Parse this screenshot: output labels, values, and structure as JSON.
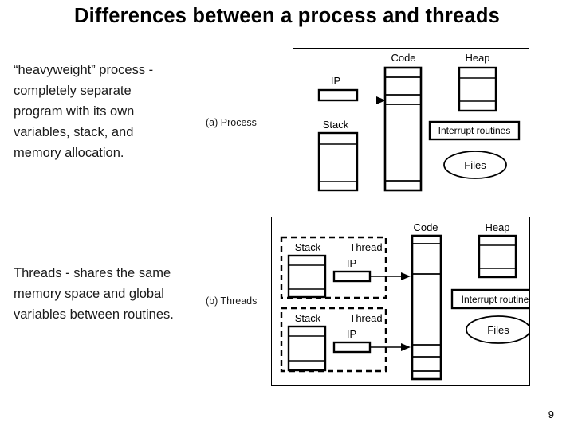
{
  "slide": {
    "title": "Differences between a process and threads",
    "page_number": "9"
  },
  "body": {
    "process_paragraph": {
      "line1": "“heavyweight” process -",
      "line2": "completely separate",
      "line3": "program with its own",
      "line4": "variables, stack, and",
      "line5": "memory allocation."
    },
    "threads_paragraph": {
      "line1": "Threads - shares the same",
      "line2": "memory space and global",
      "line3": "variables between routines."
    }
  },
  "captions": {
    "a": "(a) Process",
    "b": "(b) Threads"
  },
  "figure_process": {
    "ip_label": "IP",
    "stack_label": "Stack",
    "code_label": "Code",
    "heap_label": "Heap",
    "interrupt_label": "Interrupt routines",
    "files_label": "Files"
  },
  "figure_threads": {
    "code_label": "Code",
    "heap_label": "Heap",
    "interrupt_label": "Interrupt routines",
    "files_label": "Files",
    "threads": [
      {
        "stack_label": "Stack",
        "thread_label": "Thread",
        "ip_label": "IP"
      },
      {
        "stack_label": "Stack",
        "thread_label": "Thread",
        "ip_label": "IP"
      }
    ]
  },
  "colors": {
    "ink": "#000000",
    "background": "#ffffff",
    "body_text": "#1a1a1a"
  }
}
